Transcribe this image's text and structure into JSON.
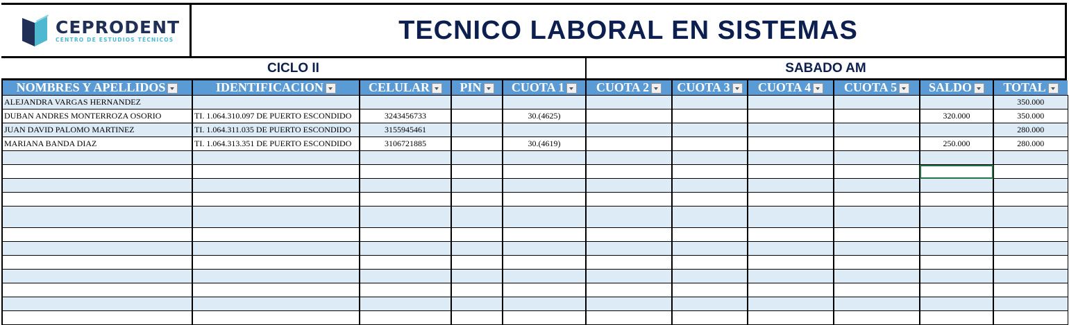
{
  "logo": {
    "brand": "CEPRODENT",
    "tagline": "CENTRO DE ESTUDIOS TÉCNICOS",
    "colors": {
      "dark": "#1f2f55",
      "light": "#4db8d0"
    }
  },
  "title": "TECNICO LABORAL EN SISTEMAS",
  "cycle": "CICLO II",
  "schedule": "SABADO AM",
  "header_color": "#5b9bd5",
  "row_alt_color": "#ddebf7",
  "columns": [
    "NOMBRES Y APELLIDOS",
    "IDENTIFICACION",
    "CELULAR",
    "PIN",
    "CUOTA 1",
    "CUOTA 2",
    "CUOTA 3",
    "CUOTA 4",
    "CUOTA 5",
    "SALDO",
    "TOTAL"
  ],
  "rows": [
    [
      "ALEJANDRA VARGAS HERNANDEZ",
      "",
      "",
      "",
      "",
      "",
      "",
      "",
      "",
      "",
      "350.000"
    ],
    [
      "DUBAN ANDRES MONTERROZA OSORIO",
      "TI. 1.064.310.097 DE PUERTO ESCONDIDO",
      "3243456733",
      "",
      "30.(4625)",
      "",
      "",
      "",
      "",
      "320.000",
      "350.000"
    ],
    [
      "JUAN DAVID PALOMO MARTINEZ",
      "TI. 1.064.311.035 DE PUERTO ESCONDIDO",
      "3155945461",
      "",
      "",
      "",
      "",
      "",
      "",
      "",
      "280.000"
    ],
    [
      "MARIANA BANDA DIAZ",
      "TI. 1.064.313.351 DE PUERTO ESCONDIDO",
      "3106721885",
      "",
      "30.(4619)",
      "",
      "",
      "",
      "",
      "250.000",
      "280.000"
    ]
  ]
}
